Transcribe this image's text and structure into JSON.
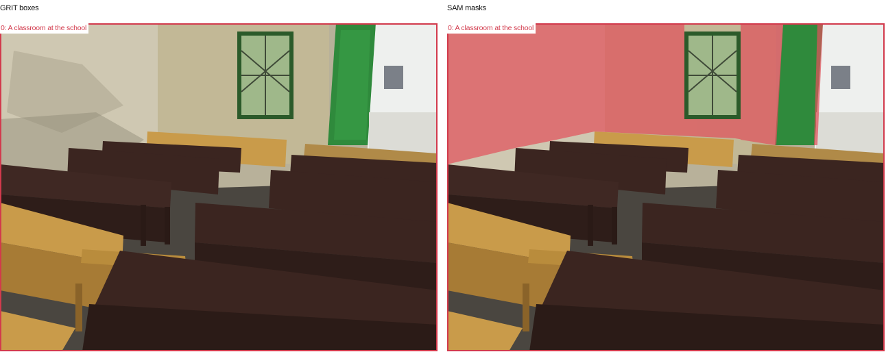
{
  "panels": {
    "left": {
      "title": "GRIT boxes",
      "label": "0: A classroom at the school"
    },
    "right": {
      "title": "SAM masks",
      "label": "0: A classroom at the school"
    }
  },
  "colors": {
    "box": "#d23a4c",
    "mask": "#e0525c",
    "wall": "#c9c0a6",
    "door": "#2f8a3c",
    "desk_dark": "#3b2520",
    "desk_light": "#c99b4a",
    "floor": "#4a4640"
  },
  "scene": {
    "description_icon": "classroom-photo",
    "objects": [
      "wall",
      "window",
      "door",
      "desks",
      "benches",
      "floor"
    ]
  }
}
